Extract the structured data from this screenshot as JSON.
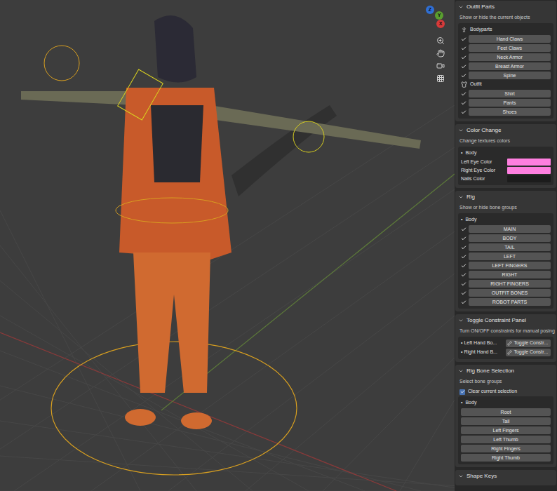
{
  "viewport": {
    "gizmo": [
      {
        "label": "Z",
        "color": "#2f6fd6"
      },
      {
        "label": "Y",
        "color": "#5a9e2f"
      },
      {
        "label": "X",
        "color": "#d63a3a"
      }
    ]
  },
  "outfit_parts": {
    "title": "Outfit Parts",
    "expanded": true,
    "description": "Show or hide the current objects",
    "groups": [
      {
        "label": "Bodyparts",
        "items": [
          {
            "label": "Hand Claws",
            "checked": true
          },
          {
            "label": "Feet Claws",
            "checked": true
          },
          {
            "label": "Neck Armor",
            "checked": true
          },
          {
            "label": "Breast Armor",
            "checked": true
          },
          {
            "label": "Spine",
            "checked": true
          }
        ]
      },
      {
        "label": "Outfit",
        "items": [
          {
            "label": "Shirt",
            "checked": true
          },
          {
            "label": "Pants",
            "checked": true
          },
          {
            "label": "Shoes",
            "checked": true
          }
        ]
      }
    ]
  },
  "color_change": {
    "title": "Color Change",
    "expanded": true,
    "description": "Change textures colors",
    "bullet": "•",
    "group": "Body",
    "colors": [
      {
        "label": "Left Eye Color",
        "color": "#ff7fe0"
      },
      {
        "label": "Right Eye Color",
        "color": "#ff7fe0"
      },
      {
        "label": "Nails Color",
        "color": "#1c1c1c"
      }
    ]
  },
  "rig": {
    "title": "Rig",
    "expanded": true,
    "description": "Show or hide bone groups",
    "bullet": "•",
    "group": "Body",
    "items": [
      {
        "label": "MAIN",
        "checked": true
      },
      {
        "label": "BODY",
        "checked": true
      },
      {
        "label": "TAIL",
        "checked": true
      },
      {
        "label": "LEFT",
        "checked": true
      },
      {
        "label": "LEFT FINGERS",
        "checked": true
      },
      {
        "label": "RIGHT",
        "checked": true
      },
      {
        "label": "RIGHT FINGERS",
        "checked": true
      },
      {
        "label": "OUTFIT BONES",
        "checked": true
      },
      {
        "label": "ROBOT PARTS",
        "checked": true
      }
    ]
  },
  "toggle_constraint_panel": {
    "title": "Toggle Constraint Panel",
    "expanded": true,
    "description": "Turn ON/OFF constraints for manual posing",
    "bullet": "•",
    "rows": [
      {
        "label": "Left Hand Bo...",
        "button": "Toggle Constr..."
      },
      {
        "label": "Right Hand B...",
        "button": "Toggle Constr..."
      }
    ]
  },
  "rig_bone_selection": {
    "title": "Rig Bone Selection",
    "expanded": true,
    "description": "Select bone groups",
    "clear_selection": {
      "label": "Clear current selection",
      "checked": true
    },
    "bullet": "•",
    "group": "Body",
    "buttons": [
      "Root",
      "Tail",
      "Left Fingers",
      "Left Thumb",
      "Right Fingers",
      "Right Thumb"
    ]
  },
  "shape_keys": {
    "title": "Shape Keys",
    "expanded": true
  }
}
